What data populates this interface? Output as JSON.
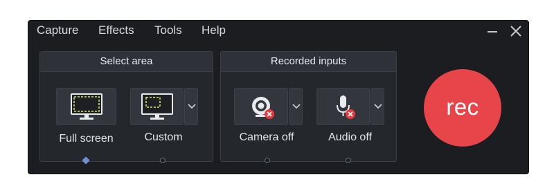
{
  "menu": {
    "items": [
      "Capture",
      "Effects",
      "Tools",
      "Help"
    ]
  },
  "window_controls": {
    "minimize_icon": "minimize-icon",
    "close_icon": "close-icon"
  },
  "select_area": {
    "title": "Select area",
    "full_screen": {
      "label": "Full screen",
      "icon": "monitor-fullscreen-icon",
      "selected": true
    },
    "custom": {
      "label": "Custom",
      "icon": "monitor-custom-icon",
      "selected": false
    }
  },
  "recorded_inputs": {
    "title": "Recorded inputs",
    "camera": {
      "label": "Camera off",
      "icon": "webcam-off-icon",
      "selected": false
    },
    "audio": {
      "label": "Audio off",
      "icon": "microphone-off-icon",
      "selected": false
    }
  },
  "record_button": {
    "label": "rec",
    "color": "#e8454a"
  },
  "colors": {
    "window_bg": "#1b1d21",
    "panel_bg": "#24272c",
    "accent_dot": "#6d8fd1",
    "off_badge": "#e53a3e",
    "screen_outline": "#d6e86a"
  }
}
